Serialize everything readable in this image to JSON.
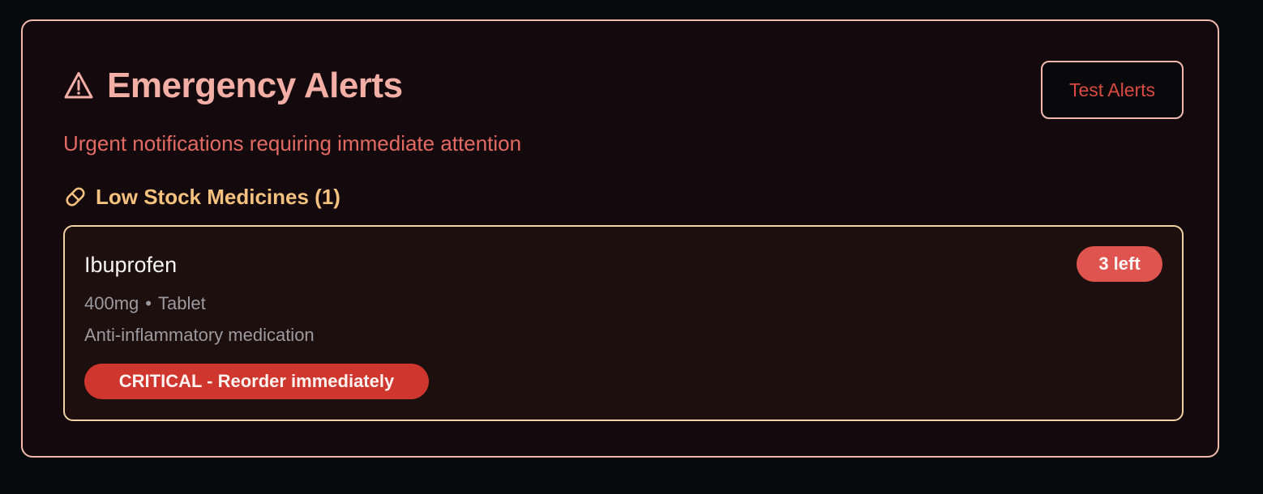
{
  "panel": {
    "title": "Emergency Alerts",
    "subtitle": "Urgent notifications requiring immediate attention",
    "test_button_label": "Test Alerts",
    "title_icon": "warning-triangle-icon"
  },
  "low_stock": {
    "section_icon": "pill-icon",
    "heading": "Low Stock Medicines (1)",
    "items": [
      {
        "name": "Ibuprofen",
        "strength": "400mg",
        "separator": "•",
        "form": "Tablet",
        "description": "Anti-inflammatory medication",
        "count_badge": "3 left",
        "severity_badge": "CRITICAL - Reorder immediately"
      }
    ]
  },
  "colors": {
    "background": "#08090c",
    "panel_background": "#140a0d",
    "panel_border": "#f3b9ad",
    "title": "#f3aea6",
    "subtitle": "#e26a63",
    "button_text": "#d94b42",
    "section_title": "#f4c17f",
    "card_border": "#f0d2a4",
    "count_badge": "#df544f",
    "critical_badge": "#cf362e"
  }
}
